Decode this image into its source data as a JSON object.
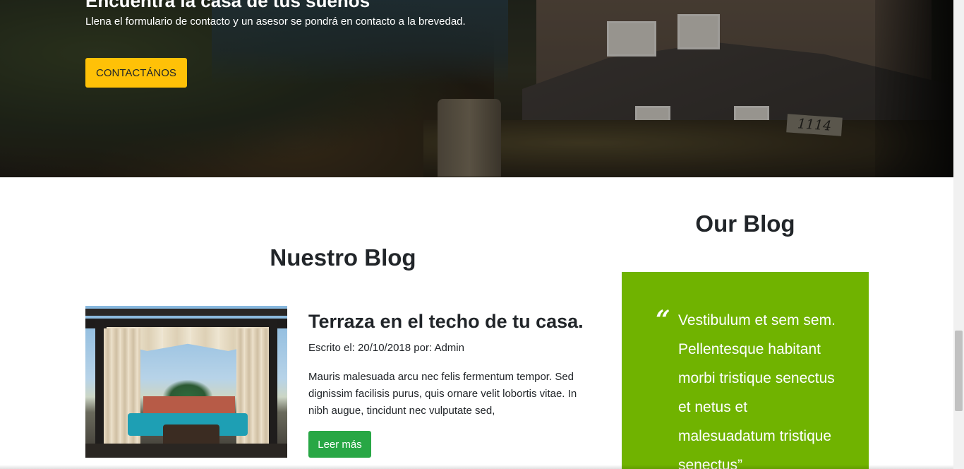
{
  "hero": {
    "title": "Encuentra la casa de tus sueños",
    "subtitle": "Llena el formulario de contacto y un asesor se pondrá en contacto a la brevedad.",
    "cta_label": "CONTACTÁNOS",
    "sign_number": "1114"
  },
  "blog": {
    "heading": "Nuestro Blog",
    "post": {
      "image_icon": "terrace-photo",
      "title": "Terraza en el techo de tu casa.",
      "meta": "Escrito el: 20/10/2018 por: Admin",
      "excerpt": "Mauris malesuada arcu nec felis fermentum tempor. Sed dignissim facilisis purus, quis ornare velit lobortis vitae. In nibh augue, tincidunt nec vulputate sed,",
      "read_more_label": "Leer más"
    }
  },
  "sidebar": {
    "heading": "Our Blog",
    "quote_mark": "“",
    "quote_text": "Vestibulum et sem sem. Pellentesque habitant morbi tristique senectus et netus et malesuadatum tristique senectus”"
  },
  "colors": {
    "cta": "#ffc107",
    "read_more": "#28a745",
    "quote_bg": "#70b300"
  }
}
